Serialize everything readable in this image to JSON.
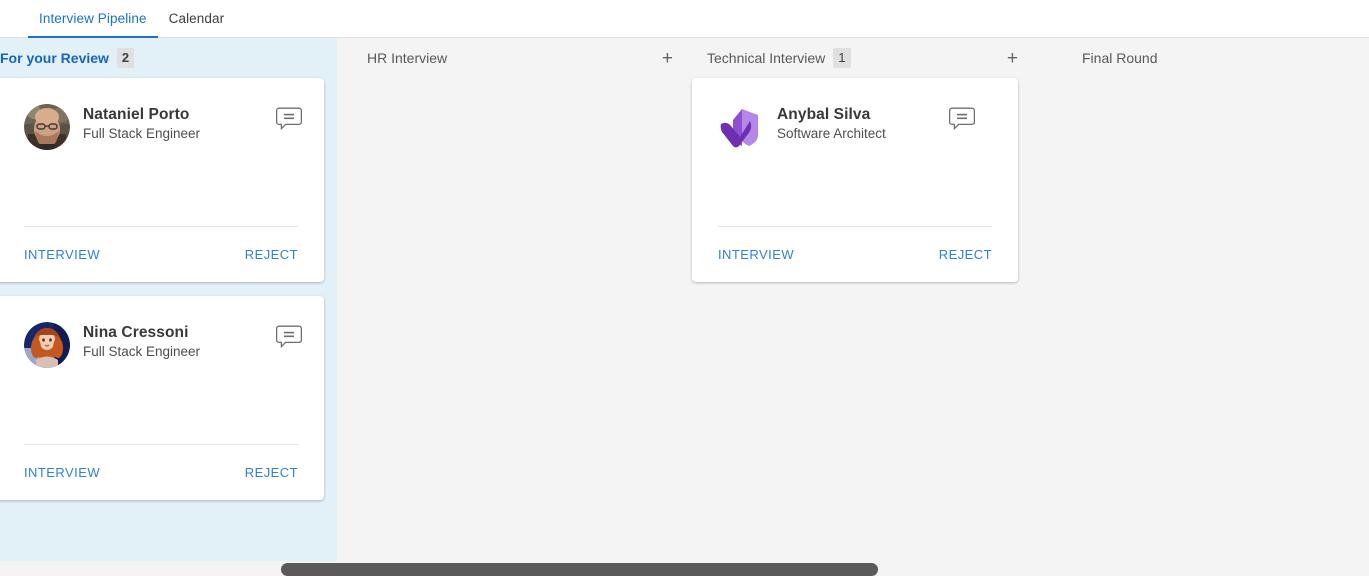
{
  "tabs": [
    {
      "label": "Interview Pipeline",
      "active": true
    },
    {
      "label": "Calendar",
      "active": false
    }
  ],
  "columns": [
    {
      "id": "for-your-review",
      "title": "For your Review",
      "count": "2",
      "has_add": false,
      "add_label": "+",
      "cards": [
        {
          "name": "Nataniel Porto",
          "role": "Full Stack Engineer",
          "avatar_kind": "photo-male",
          "chat_icon": "comment-icon",
          "primary_action": "INTERVIEW",
          "secondary_action": "REJECT"
        },
        {
          "name": "Nina Cressoni",
          "role": "Full Stack Engineer",
          "avatar_kind": "photo-female",
          "chat_icon": "comment-icon",
          "primary_action": "INTERVIEW",
          "secondary_action": "REJECT"
        }
      ]
    },
    {
      "id": "hr-interview",
      "title": "HR Interview",
      "count": "",
      "has_add": true,
      "add_label": "+",
      "cards": []
    },
    {
      "id": "technical-interview",
      "title": "Technical Interview",
      "count": "1",
      "has_add": true,
      "add_label": "+",
      "cards": [
        {
          "name": "Anybal Silva",
          "role": "Software Architect",
          "avatar_kind": "logo-purple",
          "chat_icon": "comment-icon",
          "primary_action": "INTERVIEW",
          "secondary_action": "REJECT"
        }
      ]
    },
    {
      "id": "final-round",
      "title": "Final Round",
      "count": "",
      "has_add": false,
      "add_label": "+",
      "cards": []
    }
  ],
  "colors": {
    "accent_blue": "#1a73c8",
    "review_column_bg": "#e2f0f8",
    "column_bg": "#f4f4f4",
    "action_link": "#2f80d8",
    "badge_bg": "#e0e0e0",
    "scrollbar_thumb": "#5a5a5a",
    "logo_purple_dark": "#6f2fb5",
    "logo_purple_light": "#b388e6"
  },
  "scrollbar": {
    "name": "horizontal-scrollbar"
  }
}
